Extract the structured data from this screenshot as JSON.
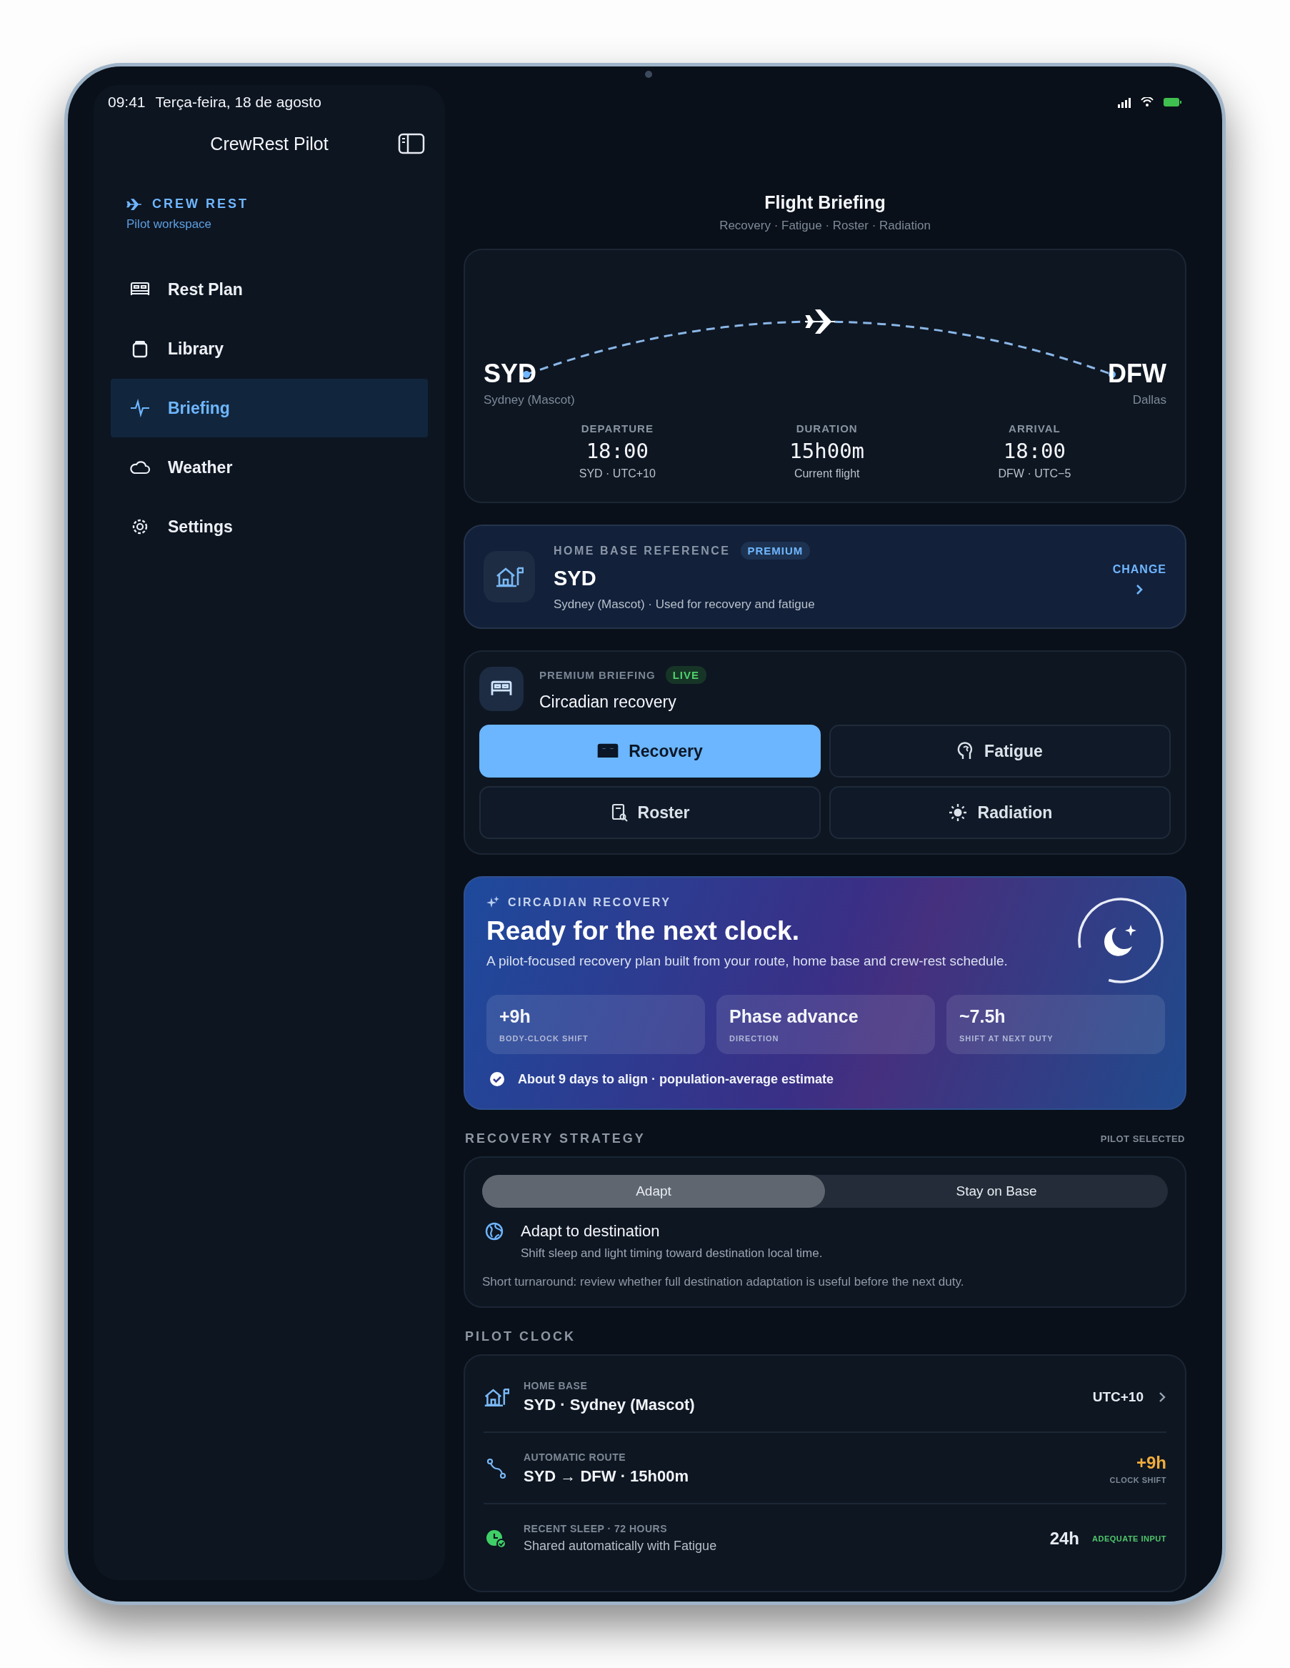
{
  "status_bar": {
    "time": "09:41",
    "date": "Terça-feira, 18 de agosto"
  },
  "sidebar": {
    "title": "CrewRest Pilot",
    "brand": "CREW REST",
    "brand_subtitle": "Pilot workspace",
    "items": [
      {
        "label": "Rest Plan",
        "selected": false
      },
      {
        "label": "Library",
        "selected": false
      },
      {
        "label": "Briefing",
        "selected": true
      },
      {
        "label": "Weather",
        "selected": false
      },
      {
        "label": "Settings",
        "selected": false
      }
    ]
  },
  "header": {
    "title": "Flight Briefing",
    "subtitle": "Recovery · Fatigue · Roster · Radiation"
  },
  "flight": {
    "origin": {
      "code": "SYD",
      "city": "Sydney (Mascot)"
    },
    "destination": {
      "code": "DFW",
      "city": "Dallas"
    },
    "stats": [
      {
        "label": "DEPARTURE",
        "value": "18:00",
        "note": "SYD · UTC+10"
      },
      {
        "label": "DURATION",
        "value": "15h00m",
        "note": "Current flight"
      },
      {
        "label": "ARRIVAL",
        "value": "18:00",
        "note": "DFW · UTC−5"
      }
    ]
  },
  "home_base": {
    "label": "HOME BASE REFERENCE",
    "badge": "PREMIUM",
    "code": "SYD",
    "description": "Sydney (Mascot) · Used for recovery and fatigue",
    "action": "CHANGE"
  },
  "briefing": {
    "label": "PREMIUM BRIEFING",
    "badge": "LIVE",
    "title": "Circadian recovery",
    "modes": [
      {
        "label": "Recovery",
        "selected": true
      },
      {
        "label": "Fatigue",
        "selected": false
      },
      {
        "label": "Roster",
        "selected": false
      },
      {
        "label": "Radiation",
        "selected": false
      }
    ]
  },
  "circadian": {
    "eyebrow": "CIRCADIAN RECOVERY",
    "title": "Ready for the next clock.",
    "description": "A pilot-focused recovery plan built from your route, home base and crew-rest schedule.",
    "metrics": [
      {
        "value": "+9h",
        "label": "BODY-CLOCK SHIFT"
      },
      {
        "value": "Phase advance",
        "label": "DIRECTION"
      },
      {
        "value": "~7.5h",
        "label": "SHIFT AT NEXT DUTY"
      }
    ],
    "note": "About 9 days to align · population-average estimate"
  },
  "strategy": {
    "heading": "RECOVERY STRATEGY",
    "tag": "PILOT SELECTED",
    "options": [
      {
        "label": "Adapt",
        "selected": true
      },
      {
        "label": "Stay on Base",
        "selected": false
      }
    ],
    "detail_title": "Adapt to destination",
    "detail_text": "Shift sleep and light timing toward destination local time.",
    "warning": "Short turnaround: review whether full destination adaptation is useful before the next duty."
  },
  "pilot_clock": {
    "heading": "PILOT CLOCK",
    "rows": [
      {
        "kind": "link",
        "label": "HOME BASE",
        "value": "SYD · Sydney (Mascot)",
        "right_value": "UTC+10"
      },
      {
        "kind": "shift",
        "label": "AUTOMATIC ROUTE",
        "value": "SYD → DFW · 15h00m",
        "right_value": "+9h",
        "right_label": "CLOCK SHIFT"
      },
      {
        "kind": "status",
        "label": "RECENT SLEEP · 72 HOURS",
        "value": "Shared automatically with Fatigue",
        "right_value": "24h",
        "right_label": "ADEQUATE INPUT"
      }
    ]
  }
}
